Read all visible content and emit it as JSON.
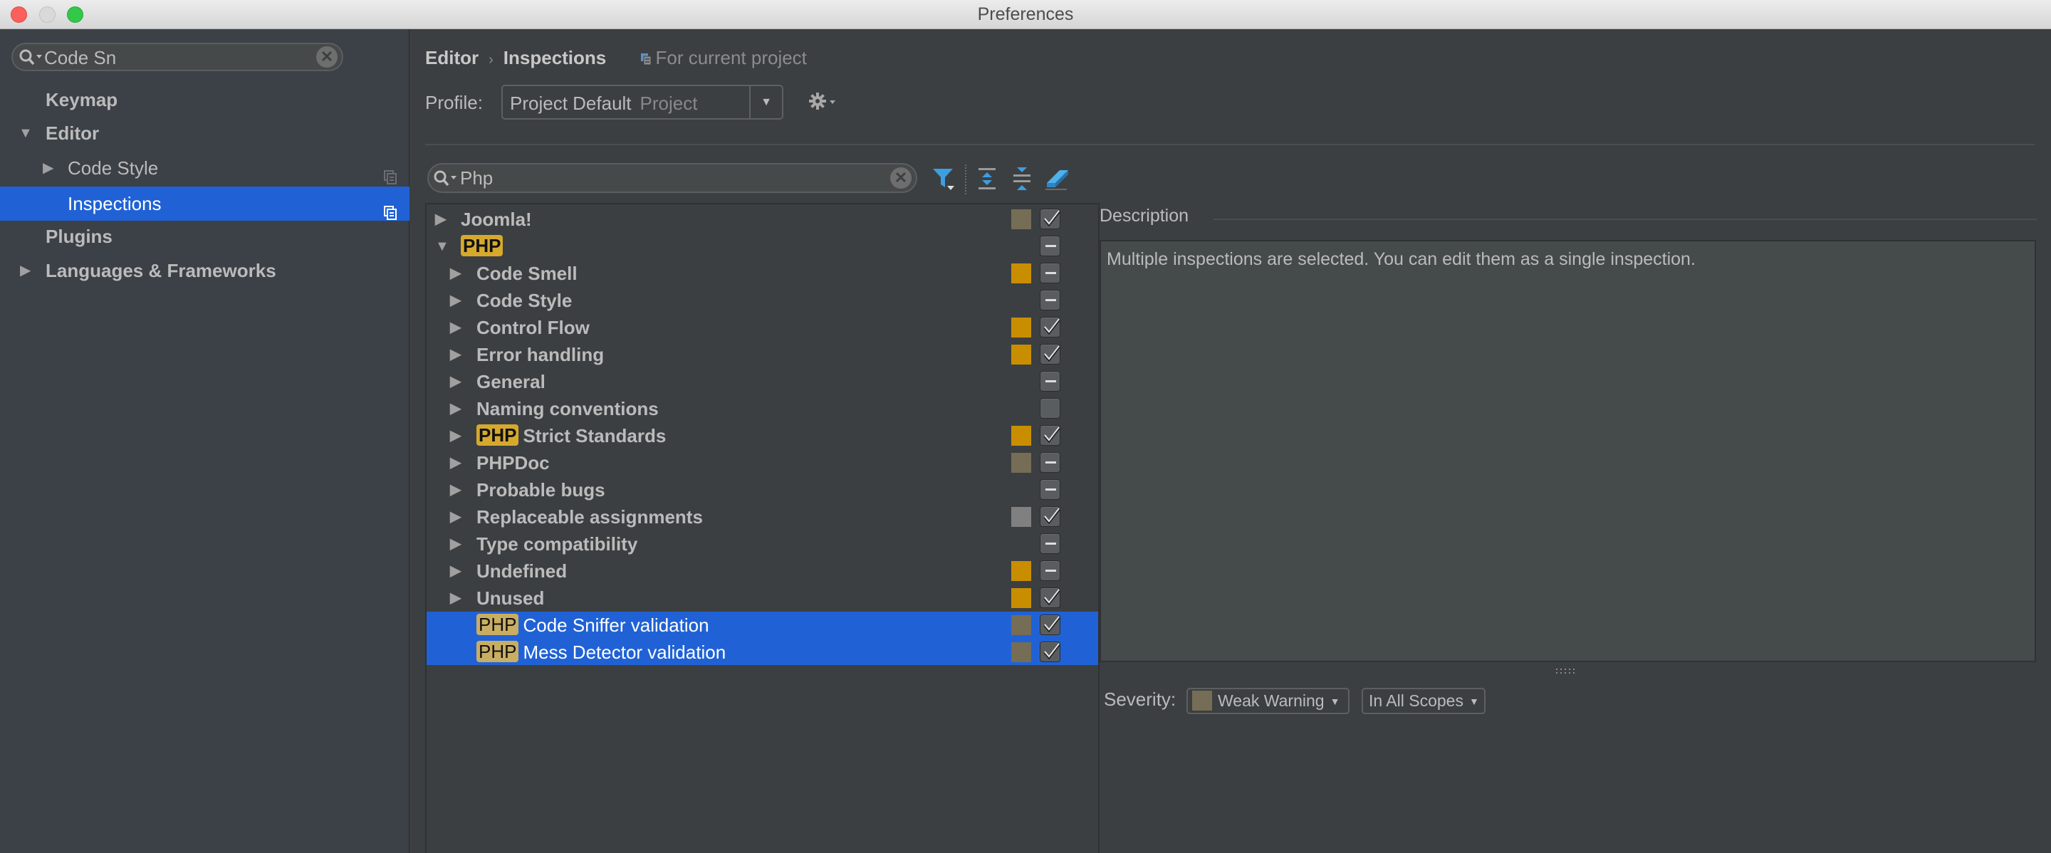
{
  "window": {
    "title": "Preferences"
  },
  "sidebar": {
    "search": {
      "value": "Code Sn",
      "placeholder": ""
    },
    "items": [
      {
        "label": "Keymap",
        "bold": true,
        "arrow": "",
        "level": 0
      },
      {
        "label": "Editor",
        "bold": true,
        "arrow": "expanded",
        "level": 0
      },
      {
        "label": "Code Style",
        "bold": false,
        "arrow": "collapsed",
        "level": 1,
        "project_icon": true
      },
      {
        "label": "Inspections",
        "bold": false,
        "arrow": "",
        "level": 1,
        "project_icon": true,
        "selected": true
      },
      {
        "label": "Plugins",
        "bold": true,
        "arrow": "",
        "level": 0
      },
      {
        "label": "Languages & Frameworks",
        "bold": true,
        "arrow": "collapsed",
        "level": 0
      }
    ]
  },
  "breadcrumb": {
    "parent": "Editor",
    "separator": "›",
    "current": "Inspections",
    "scope": "For current project"
  },
  "profile": {
    "label": "Profile:",
    "value": "Project Default",
    "type": "Project"
  },
  "tree_search": {
    "value": "Php",
    "placeholder": ""
  },
  "toolbar": {
    "filter": "filter-icon",
    "expand_all": "expand-all-icon",
    "collapse_all": "collapse-all-icon",
    "reset": "eraser-icon"
  },
  "colors": {
    "selection": "#2062d5",
    "weak_warning": "#756d55",
    "warning": "#c98e00",
    "server_problem": "#808080",
    "php_badge": "#d6a92d"
  },
  "tree": [
    {
      "label": "Joomla!",
      "badge": "",
      "level": 0,
      "arrow": "collapsed",
      "severity": "weak_warning",
      "check": "checked",
      "selected": false
    },
    {
      "label": "",
      "badge": "PHP",
      "level": 0,
      "arrow": "expanded",
      "severity": "",
      "check": "indeterminate",
      "selected": false
    },
    {
      "label": "Code Smell",
      "badge": "",
      "level": 1,
      "arrow": "collapsed",
      "severity": "warning",
      "check": "indeterminate",
      "selected": false
    },
    {
      "label": "Code Style",
      "badge": "",
      "level": 1,
      "arrow": "collapsed",
      "severity": "",
      "check": "indeterminate",
      "selected": false
    },
    {
      "label": "Control Flow",
      "badge": "",
      "level": 1,
      "arrow": "collapsed",
      "severity": "warning",
      "check": "checked",
      "selected": false
    },
    {
      "label": "Error handling",
      "badge": "",
      "level": 1,
      "arrow": "collapsed",
      "severity": "warning",
      "check": "checked",
      "selected": false
    },
    {
      "label": "General",
      "badge": "",
      "level": 1,
      "arrow": "collapsed",
      "severity": "",
      "check": "indeterminate",
      "selected": false
    },
    {
      "label": "Naming conventions",
      "badge": "",
      "level": 1,
      "arrow": "collapsed",
      "severity": "",
      "check": "unchecked",
      "selected": false
    },
    {
      "label": "Strict Standards",
      "badge": "PHP",
      "level": 1,
      "arrow": "collapsed",
      "severity": "warning",
      "check": "checked",
      "selected": false
    },
    {
      "label": "PHPDoc",
      "badge": "",
      "level": 1,
      "arrow": "collapsed",
      "severity": "weak_warning",
      "check": "indeterminate",
      "selected": false
    },
    {
      "label": "Probable bugs",
      "badge": "",
      "level": 1,
      "arrow": "collapsed",
      "severity": "",
      "check": "indeterminate",
      "selected": false
    },
    {
      "label": "Replaceable assignments",
      "badge": "",
      "level": 1,
      "arrow": "collapsed",
      "severity": "server_problem",
      "check": "checked",
      "selected": false
    },
    {
      "label": "Type compatibility",
      "badge": "",
      "level": 1,
      "arrow": "collapsed",
      "severity": "",
      "check": "indeterminate",
      "selected": false
    },
    {
      "label": "Undefined",
      "badge": "",
      "level": 1,
      "arrow": "collapsed",
      "severity": "warning",
      "check": "indeterminate",
      "selected": false
    },
    {
      "label": "Unused",
      "badge": "",
      "level": 1,
      "arrow": "collapsed",
      "severity": "warning",
      "check": "checked",
      "selected": false
    },
    {
      "label": "Code Sniffer validation",
      "badge": "PHP",
      "level": 1,
      "arrow": "",
      "severity": "weak_warning",
      "check": "checked",
      "selected": true
    },
    {
      "label": "Mess Detector validation",
      "badge": "PHP",
      "level": 1,
      "arrow": "",
      "severity": "weak_warning",
      "check": "checked",
      "selected": true
    }
  ],
  "description": {
    "title": "Description",
    "text": "Multiple inspections are selected. You can edit them as a single inspection."
  },
  "severity": {
    "label": "Severity:",
    "value": "Weak Warning",
    "scope": "In All Scopes"
  }
}
